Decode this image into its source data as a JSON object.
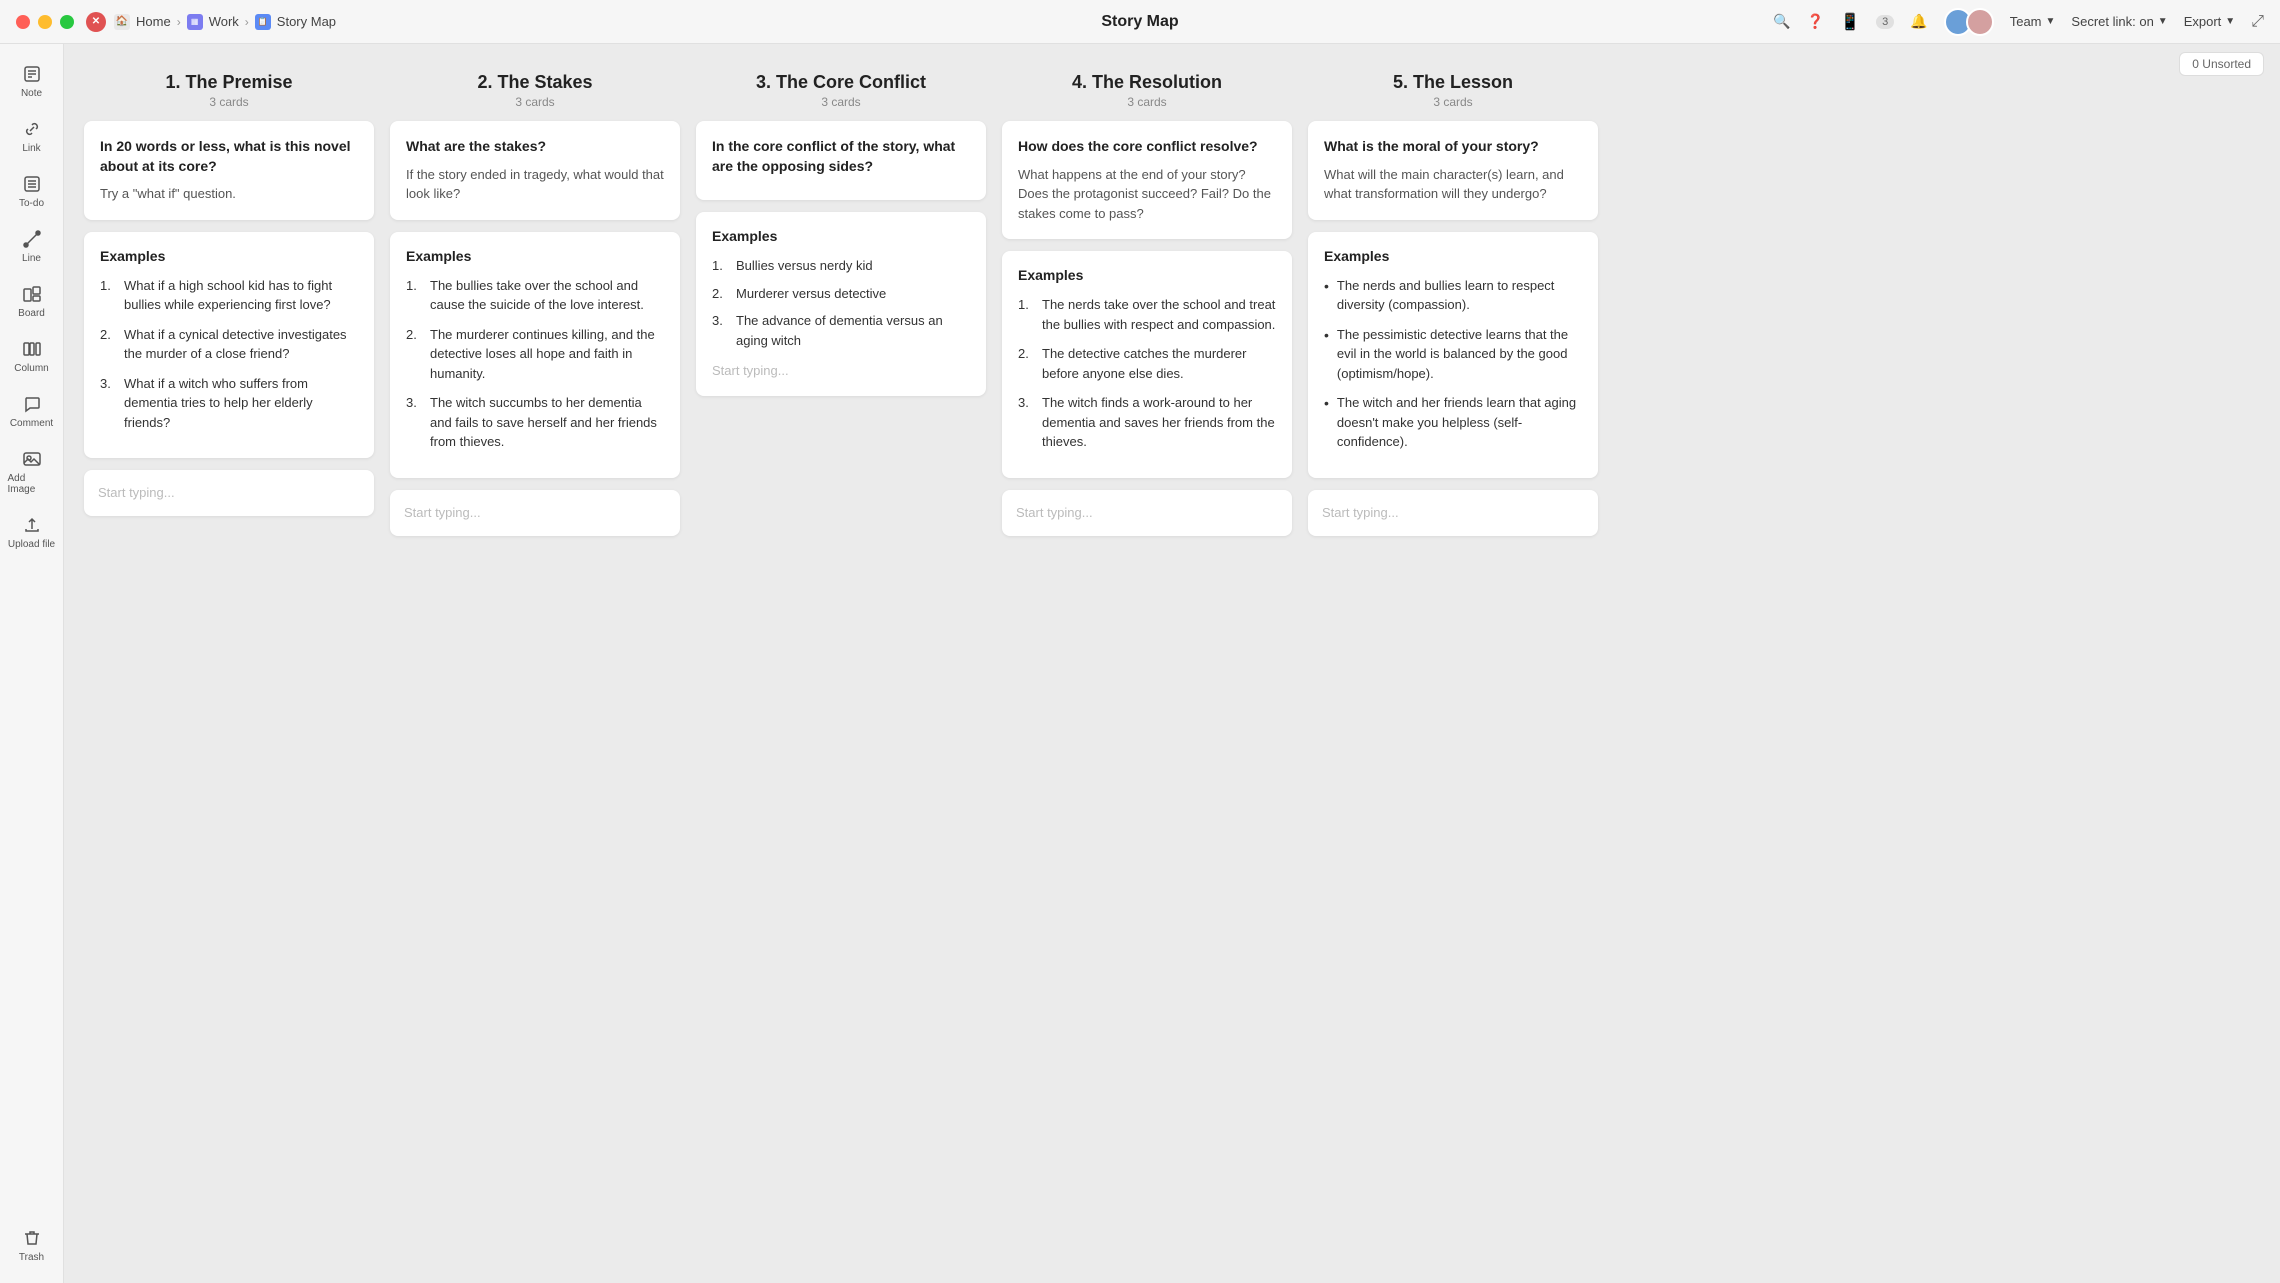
{
  "titlebar": {
    "title": "Story Map",
    "breadcrumb": {
      "home": "Home",
      "work": "Work",
      "page": "Story Map"
    },
    "team_label": "Team",
    "secret_link_label": "Secret link: on",
    "export_label": "Export",
    "notification_count": "3"
  },
  "unsorted_label": "0 Unsorted",
  "columns": [
    {
      "id": "premise",
      "title": "1. The Premise",
      "card_count": "3 cards",
      "card1": {
        "question": "In 20 words or less, what is this novel about at its core?",
        "sub": "Try a \"what if\" question."
      },
      "examples_title": "Examples",
      "examples": [
        "What if a high school kid has to fight bullies while experiencing first love?",
        "What if a cynical detective investigates the murder of a close friend?",
        "What if a witch who suffers from dementia tries to help her elderly friends?"
      ],
      "input_placeholder": "Start typing..."
    },
    {
      "id": "stakes",
      "title": "2. The Stakes",
      "card_count": "3 cards",
      "card1": {
        "question": "What are the stakes?",
        "sub": "If the story ended in tragedy, what would that look like?"
      },
      "examples_title": "Examples",
      "examples": [
        "The bullies take over the school and cause the suicide of the love interest.",
        "The murderer continues killing, and the detective loses all hope and faith in humanity.",
        "The witch succumbs to her dementia and fails to save herself and her friends from thieves."
      ],
      "input_placeholder": "Start typing..."
    },
    {
      "id": "core_conflict",
      "title": "3. The Core Conflict",
      "card_count": "3 cards",
      "card1": {
        "question": "In the core conflict of the story, what are the opposing sides?"
      },
      "examples_title": "Examples",
      "examples": [
        "Bullies versus nerdy kid",
        "Murderer versus detective",
        "The advance of dementia versus an aging witch"
      ],
      "input_placeholder": "Start typing..."
    },
    {
      "id": "resolution",
      "title": "4. The Resolution",
      "card_count": "3 cards",
      "card1": {
        "question": "How does the core conflict resolve?",
        "sub": "What happens at the end of your story? Does the protagonist succeed? Fail? Do the stakes come to pass?"
      },
      "examples_title": "Examples",
      "examples": [
        "The nerds take over the school and treat the bullies with respect and compassion.",
        "The detective catches the murderer before anyone else dies.",
        "The witch finds a work-around to her dementia and saves her friends from the thieves."
      ],
      "input_placeholder": "Start typing..."
    },
    {
      "id": "lesson",
      "title": "5. The Lesson",
      "card_count": "3 cards",
      "card1": {
        "question": "What is the moral of your story?",
        "sub": "What will the main character(s) learn, and what transformation will they undergo?"
      },
      "examples_title": "Examples",
      "bullet_examples": [
        "The nerds and bullies learn to respect diversity (compassion).",
        "The pessimistic detective learns that the evil in the world is balanced by the good (optimism/hope).",
        "The witch and her friends learn that aging doesn't make you helpless (self-confidence)."
      ],
      "input_placeholder": "Start typing..."
    }
  ],
  "sidebar": {
    "items": [
      {
        "id": "note",
        "label": "Note"
      },
      {
        "id": "link",
        "label": "Link"
      },
      {
        "id": "todo",
        "label": "To-do"
      },
      {
        "id": "line",
        "label": "Line"
      },
      {
        "id": "board",
        "label": "Board"
      },
      {
        "id": "column",
        "label": "Column"
      },
      {
        "id": "comment",
        "label": "Comment"
      },
      {
        "id": "add_image",
        "label": "Add Image"
      },
      {
        "id": "upload_file",
        "label": "Upload file"
      },
      {
        "id": "trash",
        "label": "Trash"
      }
    ]
  }
}
